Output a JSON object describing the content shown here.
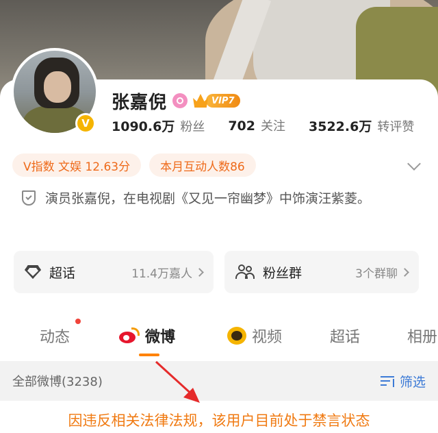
{
  "profile": {
    "name": "张嘉倪",
    "vip_level": "VIP7",
    "verified_badge": "V",
    "stats": [
      {
        "value": "1090.6万",
        "label": "粉丝"
      },
      {
        "value": "702",
        "label": "关注"
      },
      {
        "value": "3522.6万",
        "label": "转评赞"
      }
    ],
    "tags": [
      "V指数 文娱 12.63分",
      "本月互动人数86"
    ],
    "bio": "演员张嘉倪，在电视剧《又见一帘幽梦》中饰演汪紫菱。"
  },
  "panels": [
    {
      "title": "超话",
      "sub": "11.4万嘉人",
      "icon": "diamond-icon"
    },
    {
      "title": "粉丝群",
      "sub": "3个群聊",
      "icon": "people-icon"
    }
  ],
  "tabs": [
    {
      "label": "动态",
      "has_dot": true
    },
    {
      "label": "微博",
      "active": true,
      "icon": "weibo-icon"
    },
    {
      "label": "视频",
      "icon": "video-icon"
    },
    {
      "label": "超话"
    },
    {
      "label": "相册"
    }
  ],
  "feed": {
    "all_label": "全部微博(3238)",
    "filter_label": "筛选"
  },
  "notice": "因违反相关法律法规，该用户目前处于禁言状态",
  "colors": {
    "accent_orange": "#ff8200",
    "notice_orange": "#f07a12",
    "link_blue": "#3c7ad6",
    "tag_bg": "#fdf1ea",
    "verified_gold": "#f5b400"
  }
}
